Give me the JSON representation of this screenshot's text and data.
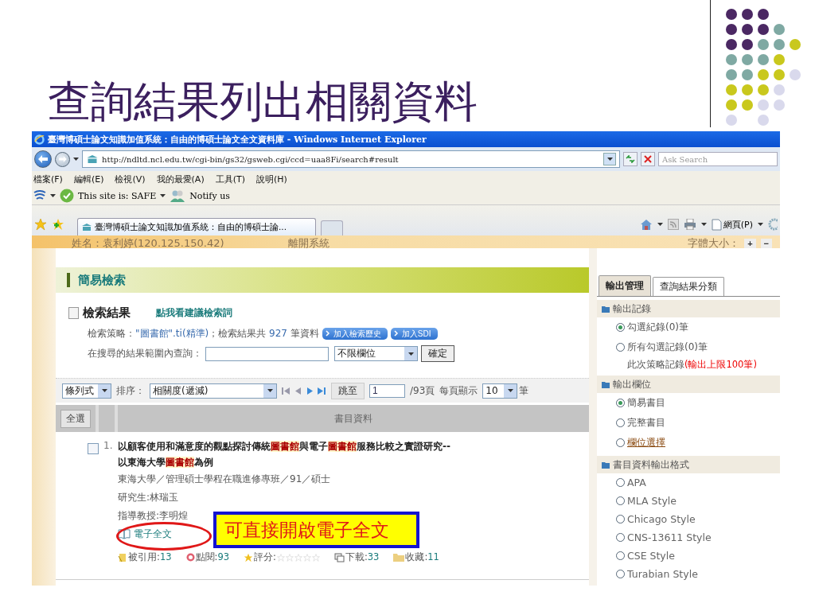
{
  "slide": {
    "title": "查詢結果列出相關資料"
  },
  "browser": {
    "title": "臺灣博碩士論文知識加值系統：自由的博碩士論文全文資料庫 - Windows Internet Explorer",
    "url": "http://ndltd.ncl.edu.tw/cgi-bin/gs32/gsweb.cgi/ccd=uaa8Fi/search#result",
    "search_placeholder": "Ask Search",
    "menu": [
      "檔案(F)",
      "編輯(E)",
      "檢視(V)",
      "我的最愛(A)",
      "工具(T)",
      "說明(H)"
    ],
    "toolbar": {
      "site_status": "This site is: SAFE",
      "notify": "Notify us"
    },
    "tabs": [
      {
        "label": "臺灣博碩士論文知識加值系統：自由的博碩士論...",
        "selected": true
      }
    ],
    "page_menu": "網頁(P)"
  },
  "page": {
    "user_info": "姓名：袁利婷(120.125.150.42)",
    "logout": "離開系統",
    "font_size_label": "字體大小：",
    "font_buttons": [
      "+",
      "−"
    ]
  },
  "search": {
    "header": "簡易檢索",
    "results_title": "檢索結果",
    "suggest_link": "點我看建議檢索詞",
    "strategy": {
      "label": "檢索策略：",
      "query": "\"圖書館\".ti(精準)",
      "middle": "；檢索結果共",
      "count": "927",
      "unit": "筆資料"
    },
    "buttons": [
      "加入檢索歷史",
      "加入SDI"
    ],
    "refine_label": "在搜尋的結果範圍內查詢：",
    "field_select": "不限欄位",
    "confirm": "確定"
  },
  "sort_bar": {
    "view": "條列式",
    "sort_label": "排序：",
    "sort": "相關度(遞減)",
    "jump": "跳至",
    "page": "1",
    "page_total": "/93頁",
    "per_page_label": "每頁顯示",
    "per_page": "10",
    "unit": "筆"
  },
  "table": {
    "select_all": "全選",
    "column": "書目資料"
  },
  "results": [
    {
      "number": "1.",
      "checked": false,
      "title_lines": [
        [
          {
            "text": "以顧客使用和滿意度的觀點探討傳統",
            "highlight": false
          },
          {
            "text": "圖書館",
            "highlight": true
          },
          {
            "text": "與電子",
            "highlight": false
          },
          {
            "text": "圖書館",
            "highlight": true
          },
          {
            "text": "服務比較之實證研究--",
            "highlight": false
          }
        ],
        [
          {
            "text": "以東海大學",
            "highlight": false
          },
          {
            "text": "圖書館",
            "highlight": true
          },
          {
            "text": "為例",
            "highlight": false
          }
        ]
      ],
      "school": "東海大學／管理碩士學程在職進修專班／91／碩士",
      "student": "研究生:林瑞玉",
      "advisor": "指導教授:李明煌",
      "fulltext": "電子全文",
      "stats": [
        {
          "kind": "cited",
          "label": "被引用:",
          "value": "13"
        },
        {
          "kind": "views",
          "label": "點閱:",
          "value": "93"
        },
        {
          "kind": "rating",
          "label": "評分:",
          "stars": 0
        },
        {
          "kind": "downloads",
          "label": "下載:",
          "value": "33"
        },
        {
          "kind": "saved",
          "label": "收藏:",
          "value": "11"
        }
      ]
    }
  ],
  "callout": {
    "text": "可直接開啟電子全文"
  },
  "output_panel": {
    "tabs": [
      {
        "label": "輸出管理",
        "selected": true
      },
      {
        "label": "查詢結果分類",
        "selected": false
      }
    ],
    "sections": [
      {
        "title": "輸出記錄",
        "options": [
          {
            "label": "勾選紀錄(0)筆",
            "selected": true,
            "kind": "plain"
          },
          {
            "label": "所有勾選記錄(0)筆",
            "selected": false,
            "kind": "plain"
          }
        ],
        "note": {
          "text": "此次策略記錄",
          "emphasis": "(輸出上限100筆)"
        }
      },
      {
        "title": "輸出欄位",
        "options": [
          {
            "label": "簡易書目",
            "selected": true,
            "kind": "plain"
          },
          {
            "label": "完整書目",
            "selected": false,
            "kind": "plain"
          },
          {
            "label": "欄位選擇",
            "selected": false,
            "kind": "link"
          }
        ]
      },
      {
        "title": "書目資料輸出格式",
        "options": [
          {
            "label": "APA",
            "selected": false,
            "kind": "plain"
          },
          {
            "label": "MLA Style",
            "selected": false,
            "kind": "plain"
          },
          {
            "label": "Chicago Style",
            "selected": false,
            "kind": "plain"
          },
          {
            "label": "CNS-13611 Style",
            "selected": false,
            "kind": "plain"
          },
          {
            "label": "CSE Style",
            "selected": false,
            "kind": "plain"
          },
          {
            "label": "Turabian Style",
            "selected": false,
            "kind": "plain"
          }
        ]
      }
    ]
  }
}
